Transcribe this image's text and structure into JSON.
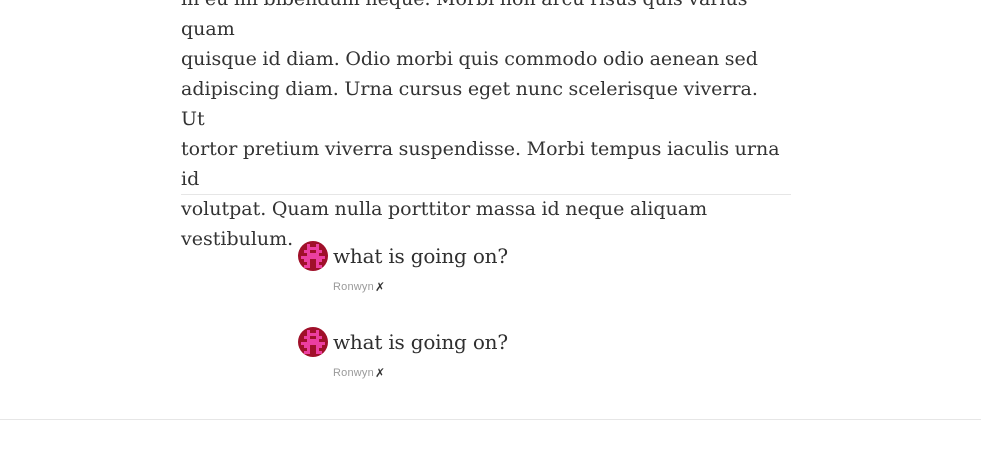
{
  "article": {
    "lines": [
      "in eu mi bibendum neque. Morbi non arcu risus quis varius quam",
      "quisque id diam. Odio morbi quis commodo odio aenean sed",
      "adipiscing diam. Urna cursus eget nunc scelerisque viverra. Ut",
      "tortor pretium viverra suspendisse. Morbi tempus iaculis urna id",
      "volutpat. Quam nulla porttitor massa id neque aliquam",
      "vestibulum."
    ]
  },
  "comments": [
    {
      "text": "what is going on?",
      "author": "Ronwyn",
      "delete_label": "✗",
      "avatar_icon": "pixel-avatar-icon"
    },
    {
      "text": "what is going on?",
      "author": "Ronwyn",
      "delete_label": "✗",
      "avatar_icon": "pixel-avatar-icon"
    }
  ],
  "colors": {
    "avatar_background": "#a0102a",
    "avatar_foreground": "#ec3fa0",
    "divider": "#e6e6e6"
  }
}
